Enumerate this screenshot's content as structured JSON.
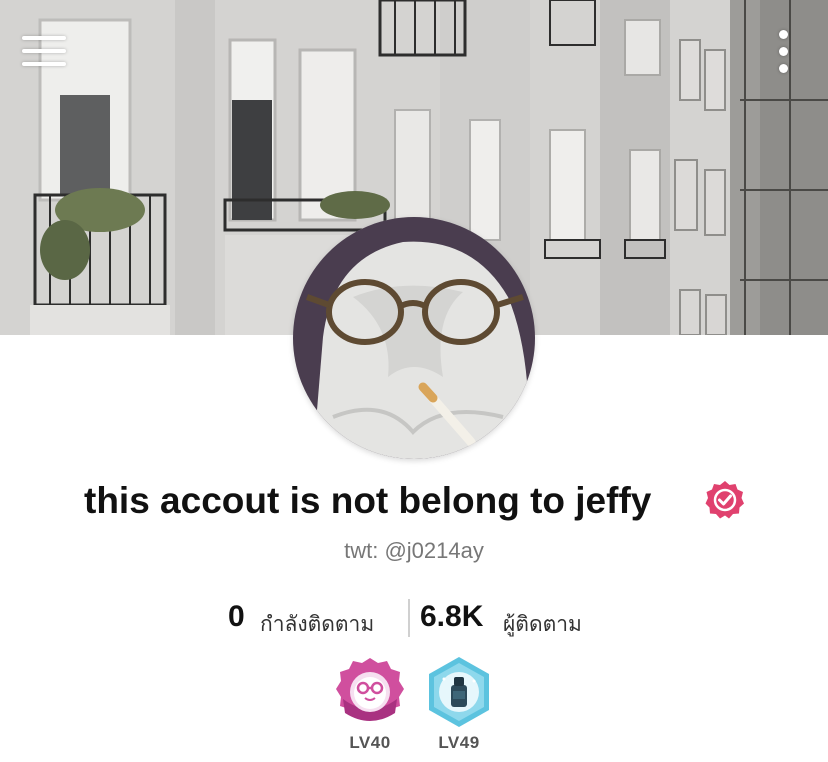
{
  "profile": {
    "display_name": "this accout is not belong to jeffy",
    "handle": "twt: @j0214ay"
  },
  "stats": {
    "following_count": "0",
    "following_label": "กำลังติดตาม",
    "followers_count": "6.8K",
    "followers_label": "ผู้ติดตาม"
  },
  "badges": [
    {
      "level": "LV40",
      "icon": "pink-glasses-face-badge",
      "color": "#d04f9e"
    },
    {
      "level": "LV49",
      "icon": "bottle-hexagon-badge",
      "color": "#5cc3df"
    }
  ],
  "icons": {
    "menu": "hamburger-menu-icon",
    "more": "vertical-dots-icon",
    "verified": "verified-check-icon"
  },
  "colors": {
    "verified": "#e0416e",
    "text_primary": "#111111",
    "text_secondary": "#777777"
  }
}
